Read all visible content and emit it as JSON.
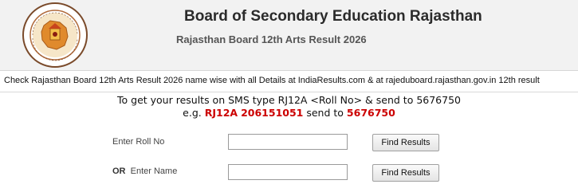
{
  "header": {
    "logo_icon": "rajasthan-board-seal-icon",
    "board_title": "Board of Secondary Education Rajasthan",
    "sub_title": "Rajasthan Board 12th Arts Result 2026",
    "background": "#f2f2f2"
  },
  "info_bar": {
    "text": "Check Rajasthan Board 12th Arts Result 2026 name wise with all Details at IndiaResults.com & at rajeduboard.rajasthan.gov.in 12th result"
  },
  "sms": {
    "line1": "To get your results on SMS type RJ12A <Roll No> & send to 5676750",
    "example_prefix": "e.g.",
    "example_code": "RJ12A",
    "example_roll": "206151051",
    "example_mid": "send to",
    "example_number": "5676750",
    "highlight_color": "#cc0000"
  },
  "form": {
    "roll_label": "Enter Roll No",
    "roll_value": "",
    "or_label": "OR",
    "name_label": "Enter Name",
    "name_value": "",
    "find_button_label": "Find Results"
  }
}
